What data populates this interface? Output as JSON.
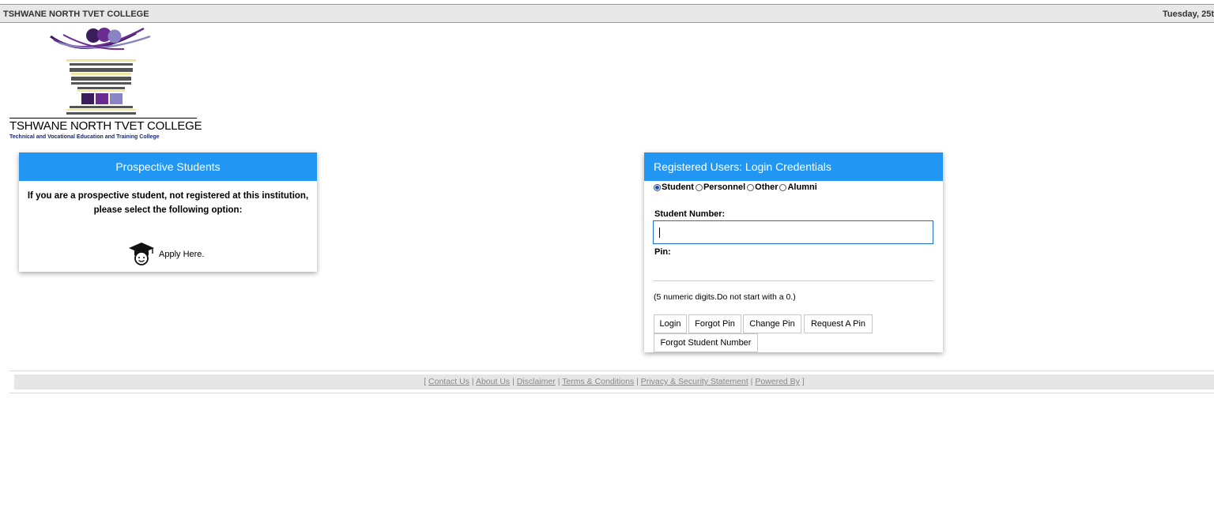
{
  "header": {
    "college_name": "TSHWANE NORTH TVET COLLEGE",
    "date_text": "Tuesday, 25t"
  },
  "logo": {
    "name": "TSHWANE NORTH TVET COLLEGE",
    "subtitle": "Technical and Vocational Education and Training College",
    "colors": {
      "purple_dark": "#3b1d5c",
      "purple": "#6a2c91",
      "lavender": "#8a84c4",
      "yellow": "#efe6a0",
      "gray": "#555555"
    }
  },
  "prospective": {
    "title": "Prospective Students",
    "description": "If you are a prospective student, not registered at this institution, please select the following option:",
    "apply_label": "Apply Here.",
    "apply_icon": "graduate-cap-icon"
  },
  "login": {
    "title": "Registered Users: Login Credentials",
    "user_types": [
      {
        "label": "Student",
        "checked": true
      },
      {
        "label": "Personnel",
        "checked": false
      },
      {
        "label": "Other",
        "checked": false
      },
      {
        "label": "Alumni",
        "checked": false
      }
    ],
    "student_number_label": "Student Number:",
    "student_number_value": "",
    "pin_label": "Pin:",
    "hint": "(5 numeric digits.Do not start with a 0.)",
    "buttons": {
      "login": "Login",
      "forgot_pin": "Forgot Pin",
      "change_pin": "Change Pin",
      "request_pin": "Request A Pin",
      "forgot_student_number": "Forgot Student Number"
    }
  },
  "footer": {
    "open_bracket": "[",
    "close_bracket": "]",
    "sep": "|",
    "links": [
      "Contact Us",
      "About Us",
      "Disclaimer",
      "Terms & Conditions",
      "Privacy & Security Statement",
      "Powered By"
    ]
  },
  "colors": {
    "accent": "#2196f3",
    "input_border": "#1a73c9"
  }
}
